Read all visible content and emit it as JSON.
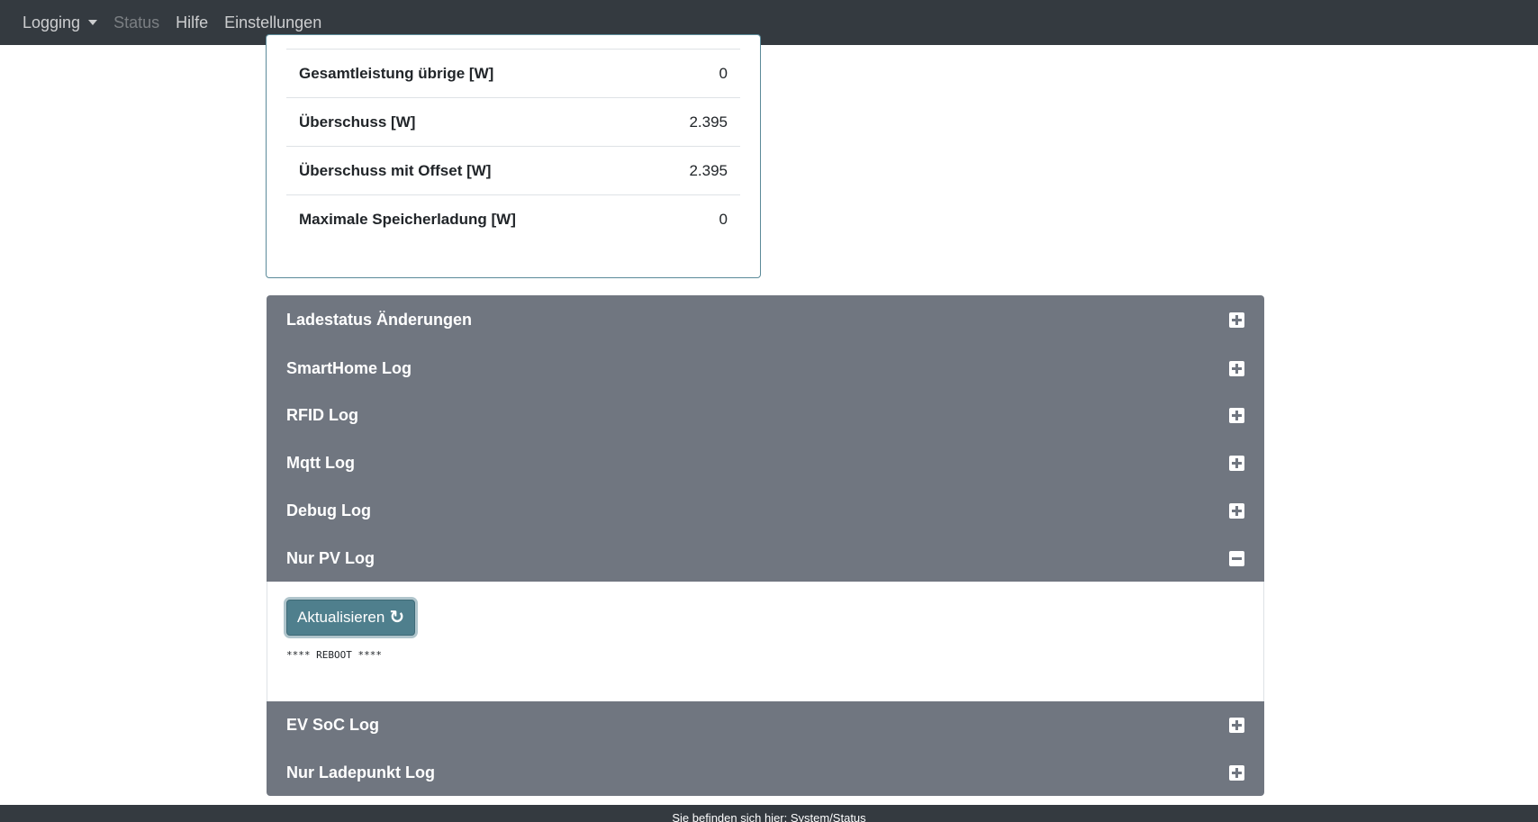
{
  "navbar": {
    "items": [
      {
        "label": "Logging"
      },
      {
        "label": "Status"
      },
      {
        "label": "Hilfe"
      },
      {
        "label": "Einstellungen"
      }
    ]
  },
  "stats": {
    "rows": [
      {
        "label": "Gesamtleistung übrige [W]",
        "value": "0"
      },
      {
        "label": "Überschuss [W]",
        "value": "2.395"
      },
      {
        "label": "Überschuss mit Offset [W]",
        "value": "2.395"
      },
      {
        "label": "Maximale Speicherladung [W]",
        "value": "0"
      }
    ]
  },
  "accordion": {
    "items": [
      {
        "title": "Ladestatus Änderungen",
        "state": "collapsed",
        "icon": "plus-square-icon"
      },
      {
        "title": "SmartHome Log",
        "state": "collapsed",
        "icon": "plus-square-icon"
      },
      {
        "title": "RFID Log",
        "state": "collapsed",
        "icon": "plus-square-icon"
      },
      {
        "title": "Mqtt Log",
        "state": "collapsed",
        "icon": "plus-square-icon"
      },
      {
        "title": "Debug Log",
        "state": "collapsed",
        "icon": "plus-square-icon"
      },
      {
        "title": "Nur PV Log",
        "state": "expanded",
        "icon": "minus-square-icon"
      },
      {
        "title": "EV SoC Log",
        "state": "collapsed",
        "icon": "plus-square-icon"
      },
      {
        "title": "Nur Ladepunkt Log",
        "state": "collapsed",
        "icon": "plus-square-icon"
      }
    ],
    "expanded_panel": {
      "refresh_label": "Aktualisieren",
      "refresh_icon": "redo-icon",
      "log_text": "**** REBOOT ****"
    }
  },
  "footer": {
    "text": "Sie befinden sich hier: System/Status"
  },
  "colors": {
    "navbar_bg": "#343a40",
    "accordion_header_bg": "#707680",
    "button_bg": "#4f7f8d",
    "card_border": "#5b8a99"
  }
}
